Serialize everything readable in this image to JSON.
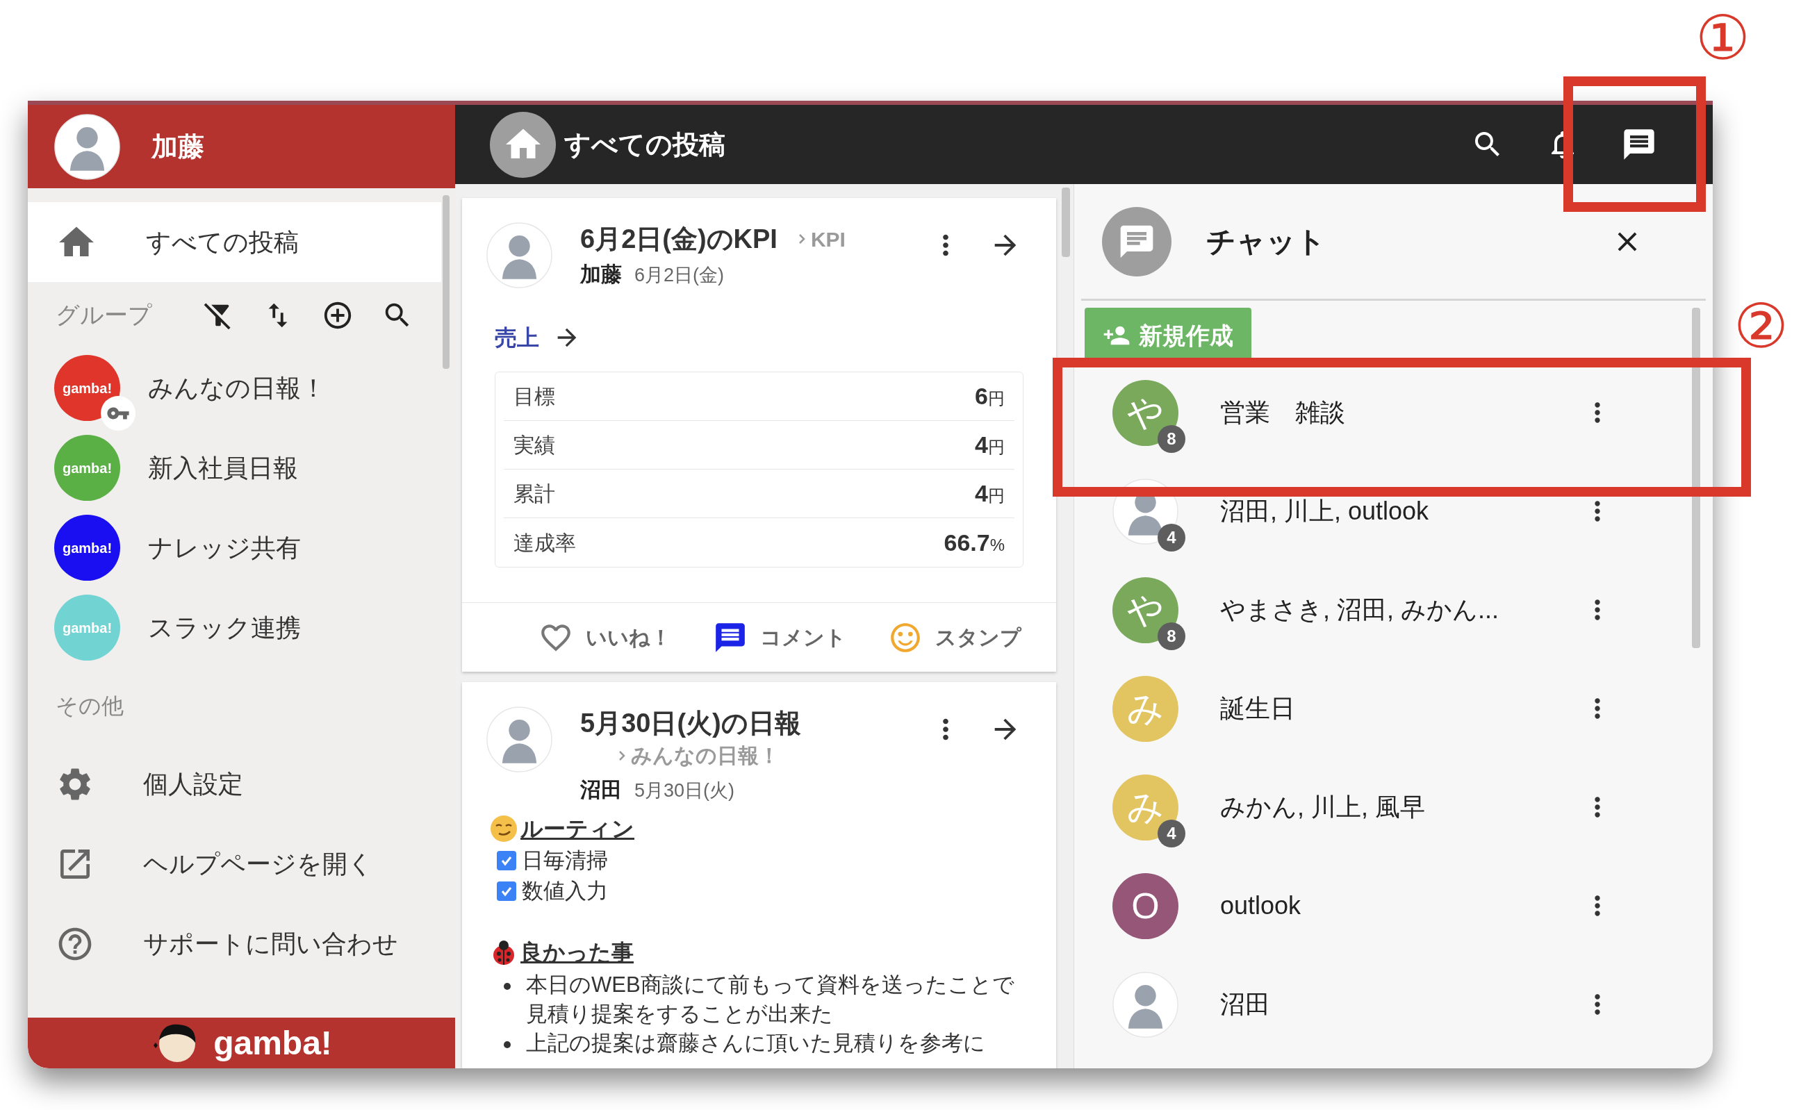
{
  "annotations": [
    {
      "kind": "chat_button",
      "label": "①"
    },
    {
      "kind": "chat_row",
      "label": "②"
    }
  ],
  "sidebar": {
    "user_name": "加藤",
    "nav": [
      {
        "label": "すべての投稿",
        "selected": true
      }
    ],
    "groups_heading": "グループ",
    "groups": [
      {
        "name": "みんなの日報！",
        "logo_text": "gamba!",
        "color": "#e0352b",
        "locked": true
      },
      {
        "name": "新入社員日報",
        "logo_text": "gamba!",
        "color": "#5aaf45",
        "locked": false
      },
      {
        "name": "ナレッジ共有",
        "logo_text": "gamba!",
        "color": "#1a0ff0",
        "locked": false
      },
      {
        "name": "スラック連携",
        "logo_text": "gamba!",
        "color": "#72d3d3",
        "locked": false
      }
    ],
    "other_heading": "その他",
    "other_items": [
      {
        "kind": "settings",
        "label": "個人設定"
      },
      {
        "kind": "external",
        "label": "ヘルプページを開く"
      },
      {
        "kind": "help",
        "label": "サポートに問い合わせ"
      }
    ],
    "footer_logo": "gamba!"
  },
  "topbar": {
    "title": "すべての投稿"
  },
  "feed": [
    {
      "kind": "kpi",
      "title": "6月2日(金)のKPI",
      "group": "KPI",
      "author": "加藤",
      "date": "6月2日(金)",
      "kpi_link": "売上",
      "rows": [
        {
          "label": "目標",
          "value": "6",
          "unit": "円"
        },
        {
          "label": "実績",
          "value": "4",
          "unit": "円"
        },
        {
          "label": "累計",
          "value": "4",
          "unit": "円"
        },
        {
          "label": "達成率",
          "value": "66.7",
          "unit": "%"
        }
      ],
      "actions": [
        {
          "kind": "like",
          "label": "いいね！"
        },
        {
          "kind": "comment",
          "label": "コメント"
        },
        {
          "kind": "stamp",
          "label": "スタンプ"
        }
      ]
    },
    {
      "kind": "report",
      "title": "5月30日(火)の日報",
      "group": "みんなの日報！",
      "author": "沼田",
      "date": "5月30日(火)",
      "sections": [
        {
          "kind": "checklist",
          "heading": "ルーティン",
          "items": [
            {
              "label": "日毎清掃",
              "checked": true
            },
            {
              "label": "数値入力",
              "checked": true
            }
          ]
        },
        {
          "kind": "bullets",
          "heading": "良かった事",
          "items": [
            "本日のWEB商談にて前もって資料を送ったことで見積り提案をすることが出来た",
            "上記の提案は齋藤さんに頂いた見積りを参考に"
          ]
        }
      ]
    }
  ],
  "chat": {
    "title": "チャット",
    "new_button": "新規作成",
    "rooms": [
      {
        "name": "営業　雑談",
        "avatar": {
          "kind": "letter",
          "letter": "や",
          "color": "#7aa95c"
        },
        "badge": "8"
      },
      {
        "name": "沼田, 川上, outlook",
        "avatar": {
          "kind": "person"
        },
        "badge": "4"
      },
      {
        "name": "やまさき, 沼田, みかん...",
        "avatar": {
          "kind": "letter",
          "letter": "や",
          "color": "#7aa95c"
        },
        "badge": "8"
      },
      {
        "name": "誕生日",
        "avatar": {
          "kind": "letter",
          "letter": "み",
          "color": "#e2c460"
        }
      },
      {
        "name": "みかん, 川上, 風早",
        "avatar": {
          "kind": "letter",
          "letter": "み",
          "color": "#e2c460"
        },
        "badge": "4"
      },
      {
        "name": "outlook",
        "avatar": {
          "kind": "letter",
          "letter": "O",
          "color": "#955678"
        }
      },
      {
        "name": "沼田",
        "avatar": {
          "kind": "person"
        }
      }
    ]
  }
}
